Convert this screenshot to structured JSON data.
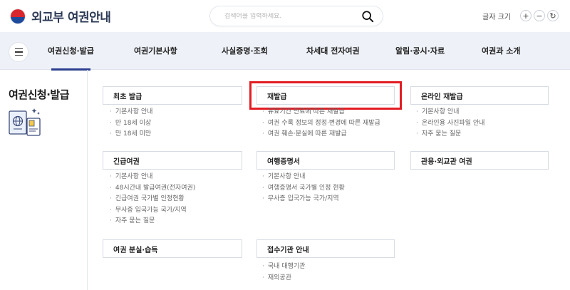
{
  "header": {
    "logo_text": "외교부 여권안내",
    "search_placeholder": "검색어를 입력하세요.",
    "font_size_label": "글자 크기",
    "font_plus": "+",
    "font_minus": "−",
    "font_reset": "↻"
  },
  "nav": {
    "items": [
      "여권신청·발급",
      "여권기본사항",
      "사실증명·조회",
      "차세대 전자여권",
      "알림·공시·자료",
      "여권과 소개"
    ],
    "active": "여권신청·발급"
  },
  "left": {
    "title": "여권신청·발급"
  },
  "cards": [
    {
      "title": "최초 발급",
      "links": [
        "기본사항 안내",
        "만 18세 이상",
        "만 18세 미만"
      ]
    },
    {
      "title": "재발급",
      "links": [
        "유효기간 만료에 따른 재발급",
        "여권 수록 정보의 정정·변경에 따른 재발급",
        "여권 훼손·분실에 따른 재발급"
      ]
    },
    {
      "title": "온라인 재발급",
      "links": [
        "기본사항 안내",
        "온라인용 사진파일 안내",
        "자주 묻는 질문"
      ]
    },
    {
      "title": "긴급여권",
      "links": [
        "기본사항 안내",
        "48시간내 발급여권(전자여권)",
        "긴급여권 국가별 인정현황",
        "무사증 입국가능 국가/지역",
        "자주 묻는 질문"
      ]
    },
    {
      "title": "여행증명서",
      "links": [
        "기본사항 안내",
        "여행증명서 국가별 인정 현황",
        "무사증 입국가능 국가/지역"
      ]
    },
    {
      "title": "관용·외교관 여권",
      "links": []
    },
    {
      "title": "여권 분실·습득",
      "links": []
    },
    {
      "title": "접수기관 안내",
      "links": [
        "국내 대행기관",
        "재외공관"
      ]
    }
  ],
  "colors": {
    "accent": "#2b3e8f",
    "highlight": "#e21c23",
    "nav_bg": "#eef1f7"
  }
}
